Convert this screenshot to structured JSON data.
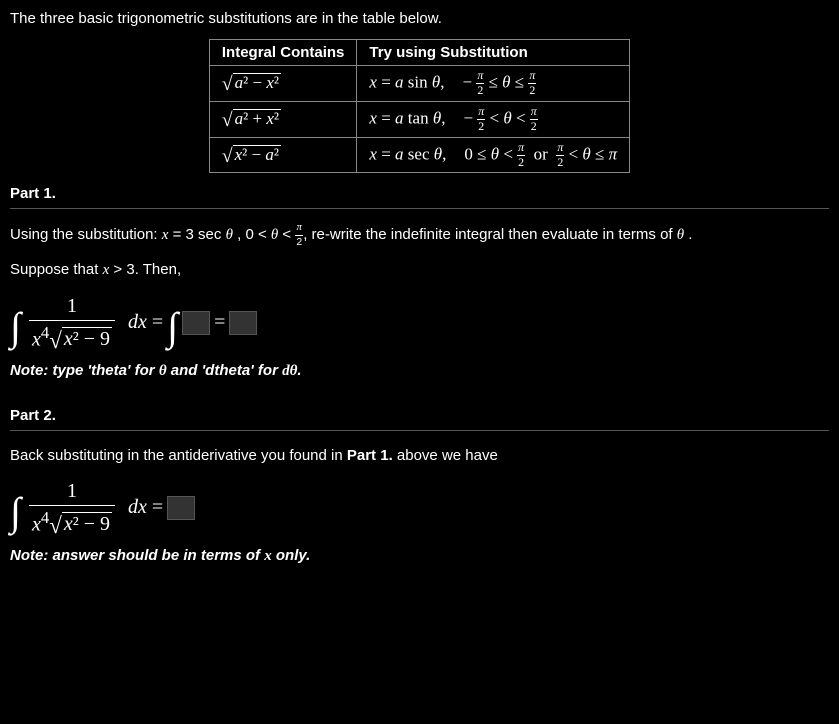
{
  "intro": "The three basic trigonometric substitutions are in the table below.",
  "table": {
    "headers": [
      "Integral Contains",
      "Try using Substitution"
    ],
    "rows": [
      {
        "contains": "√(a² − x²)",
        "sub": "x = a sin θ,",
        "range": "− π/2 ≤ θ ≤ π/2"
      },
      {
        "contains": "√(a² + x²)",
        "sub": "x = a tan θ,",
        "range": "− π/2 < θ < π/2"
      },
      {
        "contains": "√(x² − a²)",
        "sub": "x = a sec θ,",
        "range": "0 ≤ θ < π/2 or π/2 < θ ≤ π"
      }
    ]
  },
  "part1": {
    "label": "Part 1.",
    "prompt_pre": "Using the substitution: ",
    "prompt_sub": "x = 3 sec θ , 0 < θ < ",
    "prompt_post": ", re-write the indefinite integral then evaluate in terms of ",
    "suppose_pre": "Suppose that ",
    "suppose_cond": "x > 3",
    "suppose_post": ". Then,",
    "integral": {
      "num": "1",
      "den_lead": "x⁴",
      "den_radicand": "x² − 9",
      "dx": "dx",
      "equals": "="
    },
    "note_label": "Note:",
    "note_text": " type 'theta' for ",
    "note_text2": " and 'dtheta' for ",
    "note_text3": "."
  },
  "part2": {
    "label": "Part 2.",
    "prompt_pre": "Back substituting in the antiderivative you found in ",
    "prompt_bold": "Part 1.",
    "prompt_post": " above we have",
    "integral": {
      "num": "1",
      "den_lead": "x⁴",
      "den_radicand": "x² − 9",
      "dx": "dx",
      "equals": "="
    },
    "note_label": "Note:",
    "note_text": " answer should be in terms of ",
    "note_text2": " only."
  },
  "sym": {
    "theta": "θ",
    "dtheta": "dθ",
    "x": "x",
    "pi": "π",
    "half": "2"
  }
}
